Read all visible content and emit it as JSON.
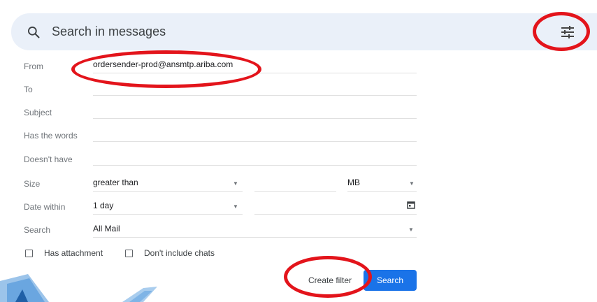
{
  "search": {
    "placeholder": "Search in messages"
  },
  "labels": {
    "from": "From",
    "to": "To",
    "subject": "Subject",
    "has_words": "Has the words",
    "doesnt_have": "Doesn't have",
    "size": "Size",
    "date_within": "Date within",
    "search": "Search"
  },
  "values": {
    "from": "ordersender-prod@ansmtp.ariba.com",
    "size_op": "greater than",
    "size_unit": "MB",
    "date_within": "1 day",
    "search_in": "All Mail"
  },
  "checkboxes": {
    "has_attachment": "Has attachment",
    "no_chats": "Don't include chats"
  },
  "buttons": {
    "create_filter": "Create filter",
    "search": "Search"
  },
  "colors": {
    "accent": "#1a73e8",
    "highlight": "#e3141b",
    "searchbar": "#eaf0f9"
  }
}
